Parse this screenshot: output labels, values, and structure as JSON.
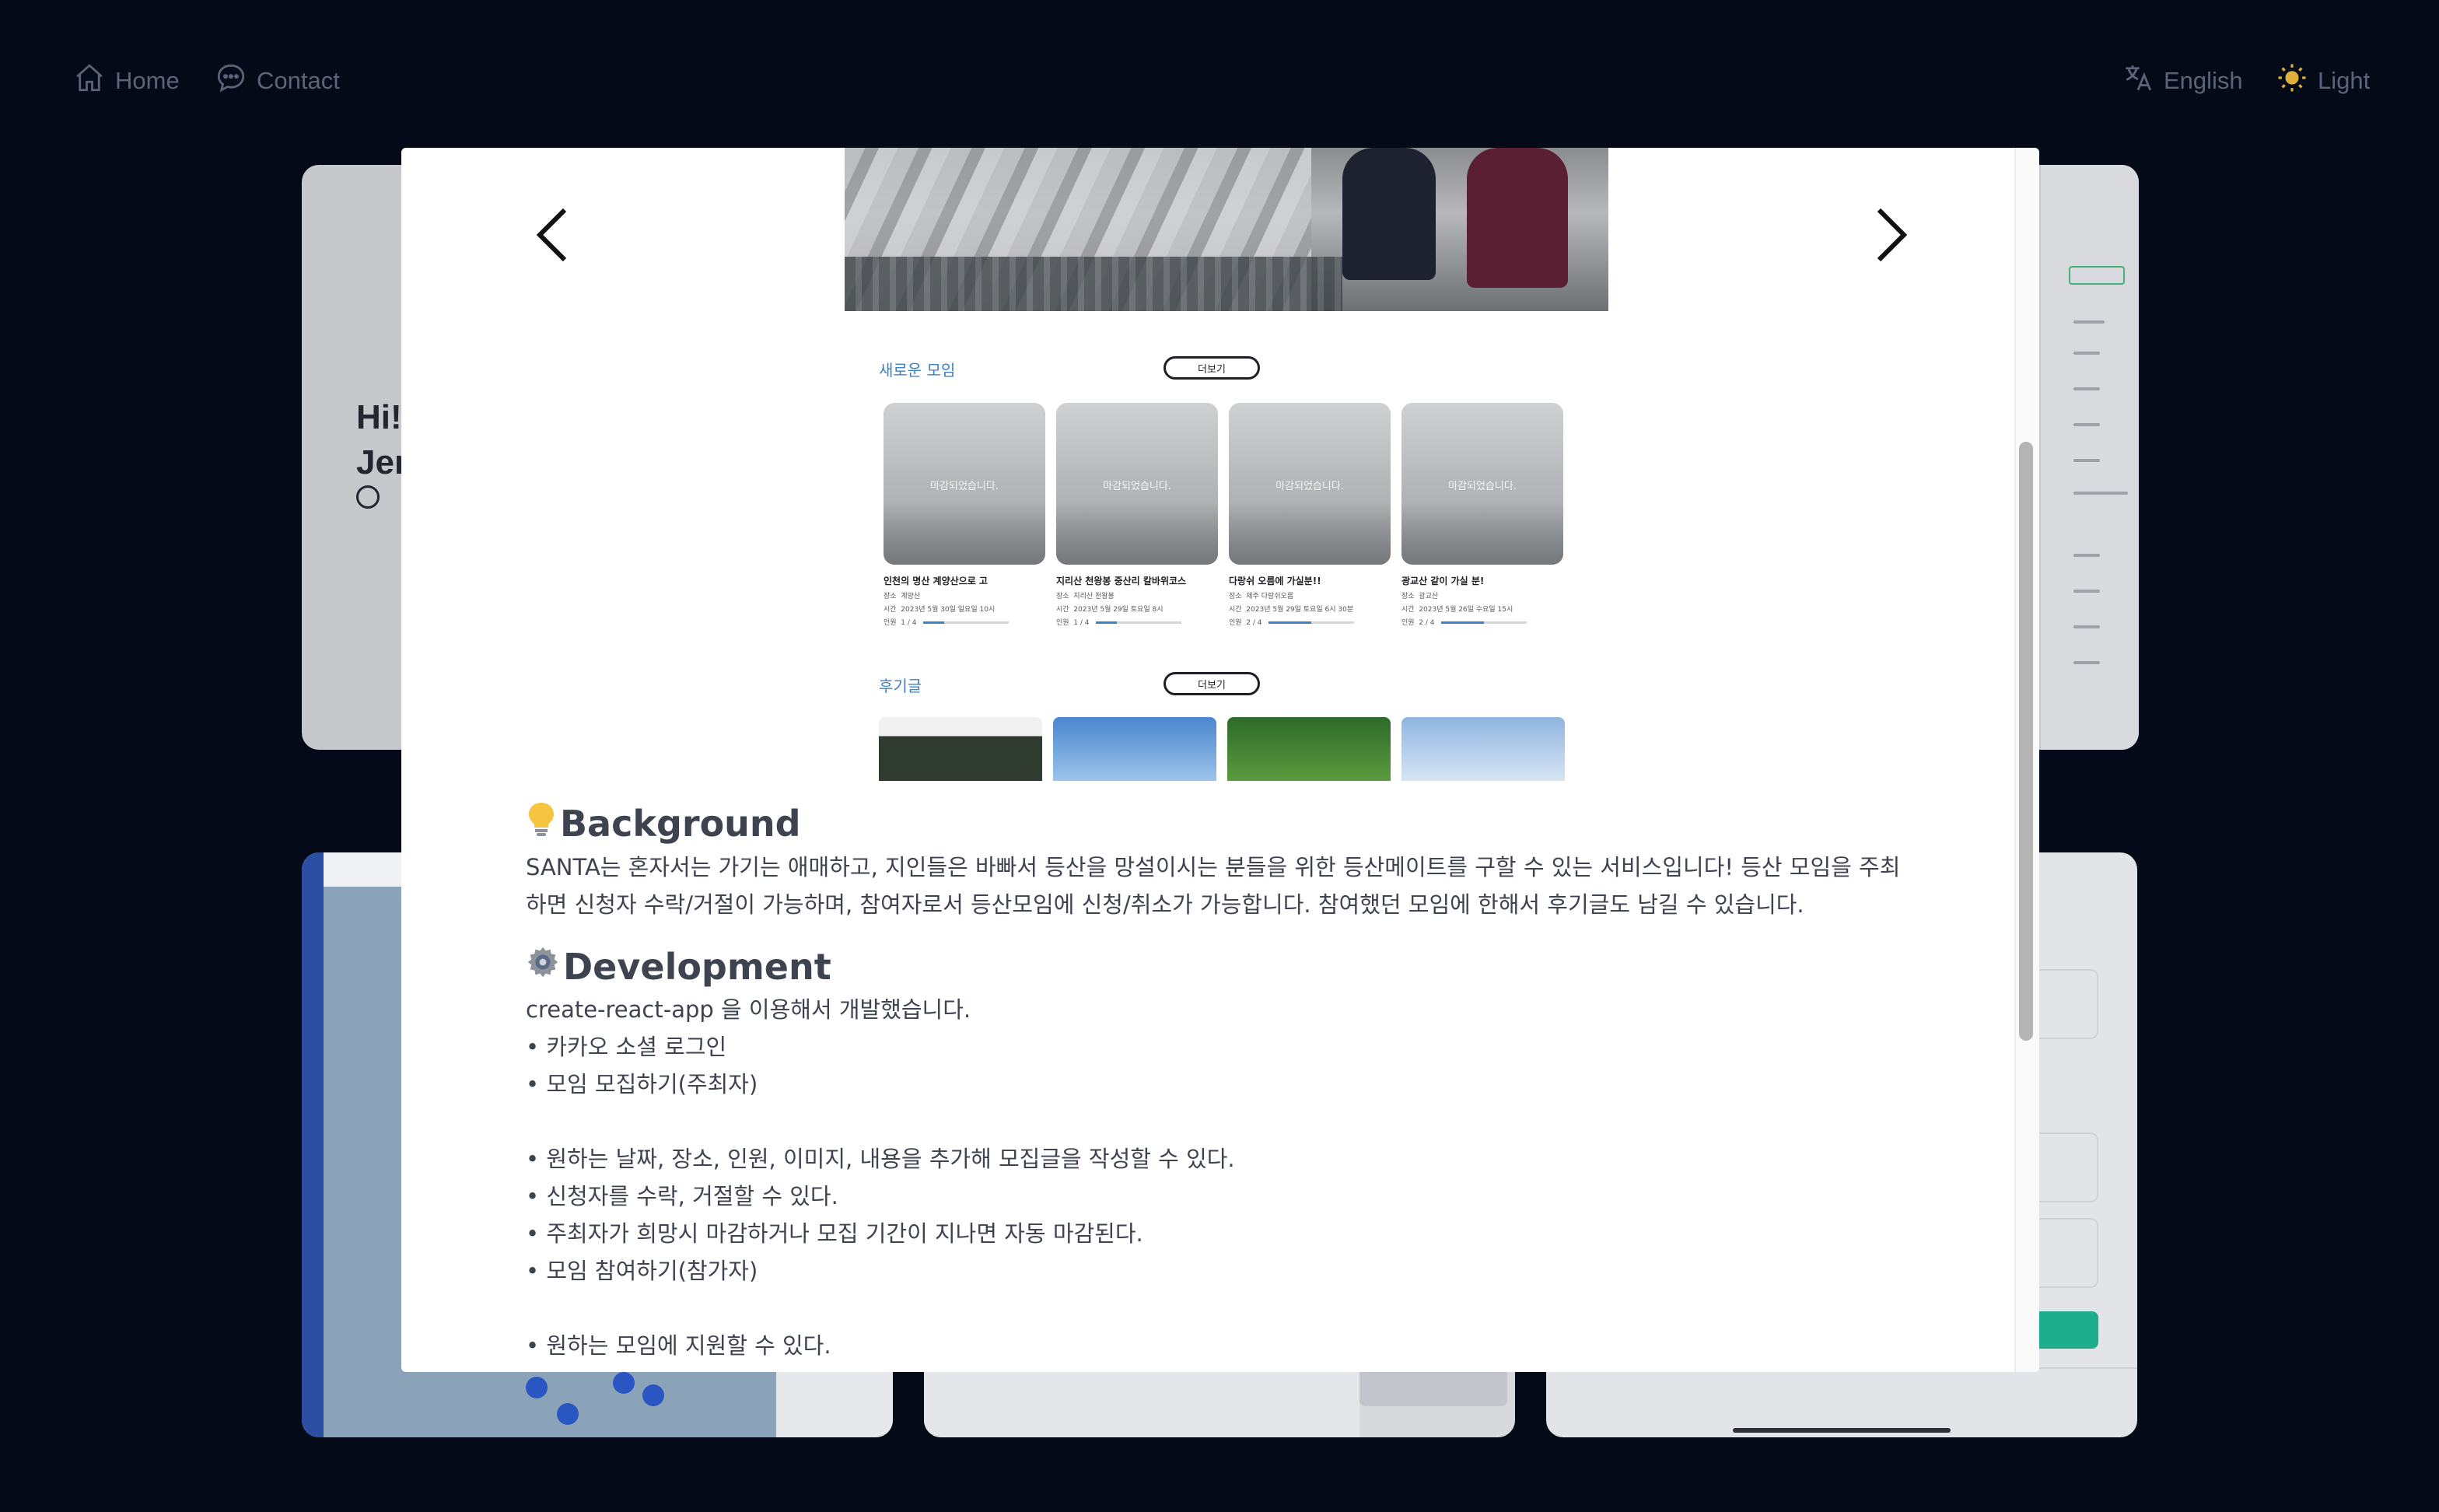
{
  "nav": {
    "home": "Home",
    "contact": "Contact",
    "language": "English",
    "theme": "Light"
  },
  "background_card": {
    "greeting_line1": "Hi! I",
    "greeting_line2": "Jenn"
  },
  "modal": {
    "screenshot": {
      "section_new": "새로운 모임",
      "section_reviews": "후기글",
      "more_label": "더보기",
      "closed_label": "마감되었습니다.",
      "meetings": [
        {
          "title": "인천의 명산 계양산으로 고",
          "place_label": "장소",
          "place": "계양산",
          "time_label": "시간",
          "time": "2023년 5월 30일 일요일 10시",
          "people_label": "인원",
          "people": "1 / 4",
          "fill": 0.25
        },
        {
          "title": "지리산 천왕봉 중산리 칼바위코스",
          "place_label": "장소",
          "place": "지리산 천왕봉",
          "time_label": "시간",
          "time": "2023년 5월 29일 토요일 8시",
          "people_label": "인원",
          "people": "1 / 4",
          "fill": 0.25
        },
        {
          "title": "다랑쉬 오름에 가실분!!",
          "place_label": "장소",
          "place": "제주 다랑쉬오름",
          "time_label": "시간",
          "time": "2023년 5월 29일 토요일 6시 30분",
          "people_label": "인원",
          "people": "2 / 4",
          "fill": 0.5
        },
        {
          "title": "광교산 같이 가실 분!",
          "place_label": "장소",
          "place": "광교산",
          "time_label": "시간",
          "time": "2023년 5월 26일 수요일 15시",
          "people_label": "인원",
          "people": "2 / 4",
          "fill": 0.5
        }
      ]
    },
    "background": {
      "heading": "Background",
      "text": "SANTA는 혼자서는 가기는 애매하고, 지인들은 바빠서 등산을 망설이시는 분들을 위한 등산메이트를 구할 수 있는 서비스입니다! 등산 모임을 주최하면 신청자 수락/거절이 가능하며, 참여자로서 등산모임에 신청/취소가 가능합니다. 참여했던 모임에 한해서 후기글도 남길 수 있습니다."
    },
    "development": {
      "heading": "Development",
      "intro": "create-react-app 을 이용해서 개발했습니다.",
      "list1": [
        "카카오 소셜 로그인",
        "모임 모집하기(주최자)"
      ],
      "list2": [
        "원하는 날짜, 장소, 인원, 이미지, 내용을 추가해 모집글을 작성할 수 있다.",
        "신청자를 수락, 거절할 수 있다.",
        "주최자가 희망시 마감하거나 모집 기간이 지나면 자동 마감된다.",
        "모임 참여하기(참가자)"
      ],
      "list3": [
        "원하는 모임에 지원할 수 있다."
      ]
    }
  },
  "colors": {
    "page_bg": "#050a18",
    "accent_blue": "#3b82c6",
    "nav_text": "#5b6478"
  },
  "icons": [
    "home-icon",
    "chat-icon",
    "translate-icon",
    "sun-icon",
    "chevron-left-icon",
    "chevron-right-icon",
    "lightbulb-icon",
    "gear-icon"
  ]
}
